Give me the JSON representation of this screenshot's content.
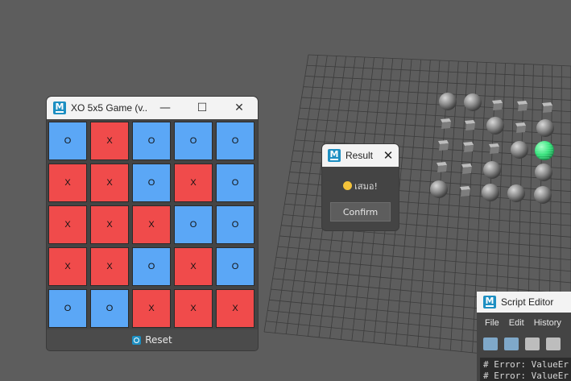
{
  "xo_window": {
    "title": "XO 5x5 Game (v...",
    "minimize": "—",
    "maximize": "☐",
    "close": "✕",
    "board": [
      [
        "O",
        "X",
        "O",
        "O",
        "O"
      ],
      [
        "X",
        "X",
        "O",
        "X",
        "O"
      ],
      [
        "X",
        "X",
        "X",
        "O",
        "O"
      ],
      [
        "X",
        "X",
        "O",
        "X",
        "O"
      ],
      [
        "O",
        "O",
        "X",
        "X",
        "X"
      ]
    ],
    "reset_label": "Reset"
  },
  "result_dialog": {
    "title": "Result",
    "close": "✕",
    "message": "เสมอ!",
    "emoji": "😐",
    "confirm_label": "Confirm"
  },
  "script_editor": {
    "title": "Script Editor",
    "menu": [
      "File",
      "Edit",
      "History"
    ],
    "console_lines": [
      "# Error: ValueEr",
      "# Error: ValueEr"
    ]
  },
  "colors": {
    "cell_o": "#5ba7f6",
    "cell_x": "#f04b4b",
    "selected_sphere": "#35e07a",
    "viewport_bg": "#5d5d5d"
  }
}
